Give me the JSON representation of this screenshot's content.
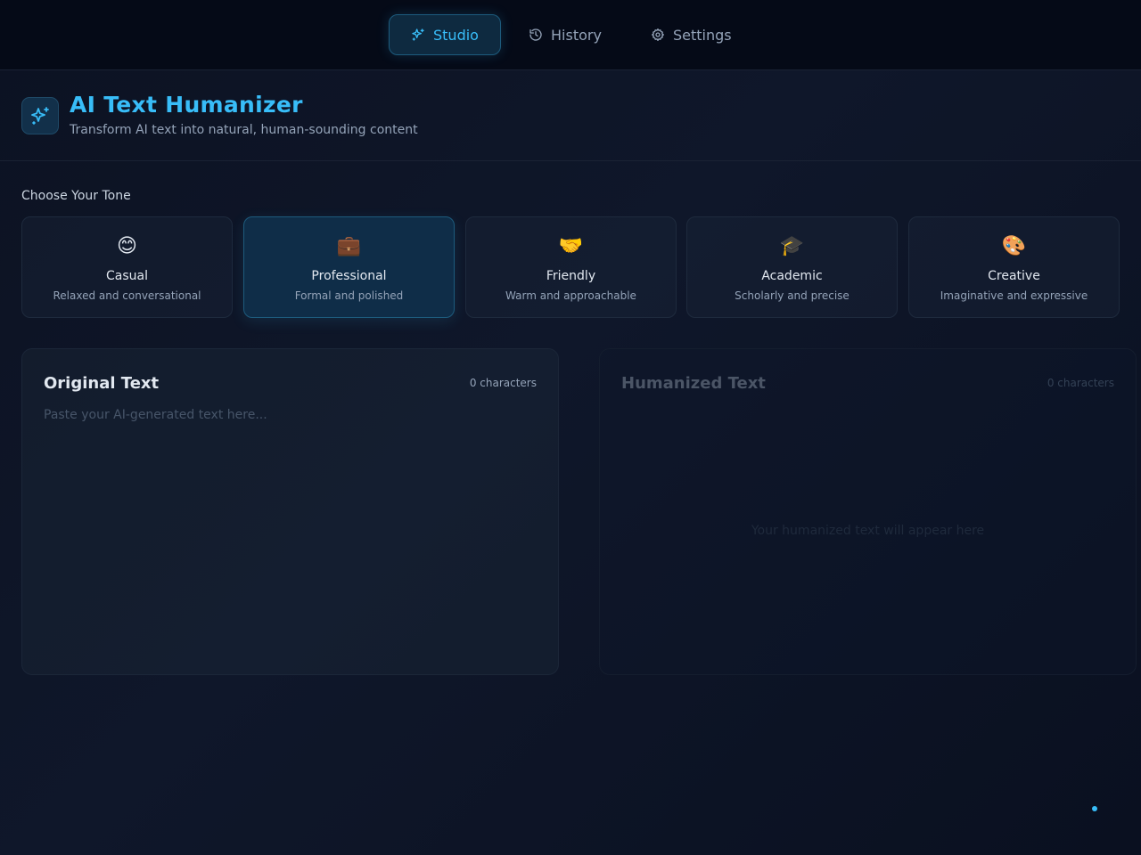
{
  "nav": {
    "items": [
      {
        "label": "Studio",
        "icon": "sparkles-icon",
        "active": true
      },
      {
        "label": "History",
        "icon": "history-icon",
        "active": false
      },
      {
        "label": "Settings",
        "icon": "gear-icon",
        "active": false
      }
    ]
  },
  "header": {
    "title": "AI Text Humanizer",
    "subtitle": "Transform AI text into natural, human-sounding content",
    "logo_icon": "sparkles-icon"
  },
  "tone": {
    "label": "Choose Your Tone",
    "options": [
      {
        "name": "Casual",
        "desc": "Relaxed and conversational",
        "icon": "😊",
        "selected": false
      },
      {
        "name": "Professional",
        "desc": "Formal and polished",
        "icon": "💼",
        "selected": true
      },
      {
        "name": "Friendly",
        "desc": "Warm and approachable",
        "icon": "🤝",
        "selected": false
      },
      {
        "name": "Academic",
        "desc": "Scholarly and precise",
        "icon": "🎓",
        "selected": false
      },
      {
        "name": "Creative",
        "desc": "Imaginative and expressive",
        "icon": "🎨",
        "selected": false
      }
    ]
  },
  "original": {
    "title": "Original Text",
    "count": "0 characters",
    "placeholder": "Paste your AI-generated text here..."
  },
  "humanized": {
    "title": "Humanized Text",
    "count": "0 characters",
    "placeholder": "Your humanized text will appear here"
  },
  "colors": {
    "accent": "#38bdf8",
    "background": "#0f172a",
    "nav_background": "#050a17"
  }
}
